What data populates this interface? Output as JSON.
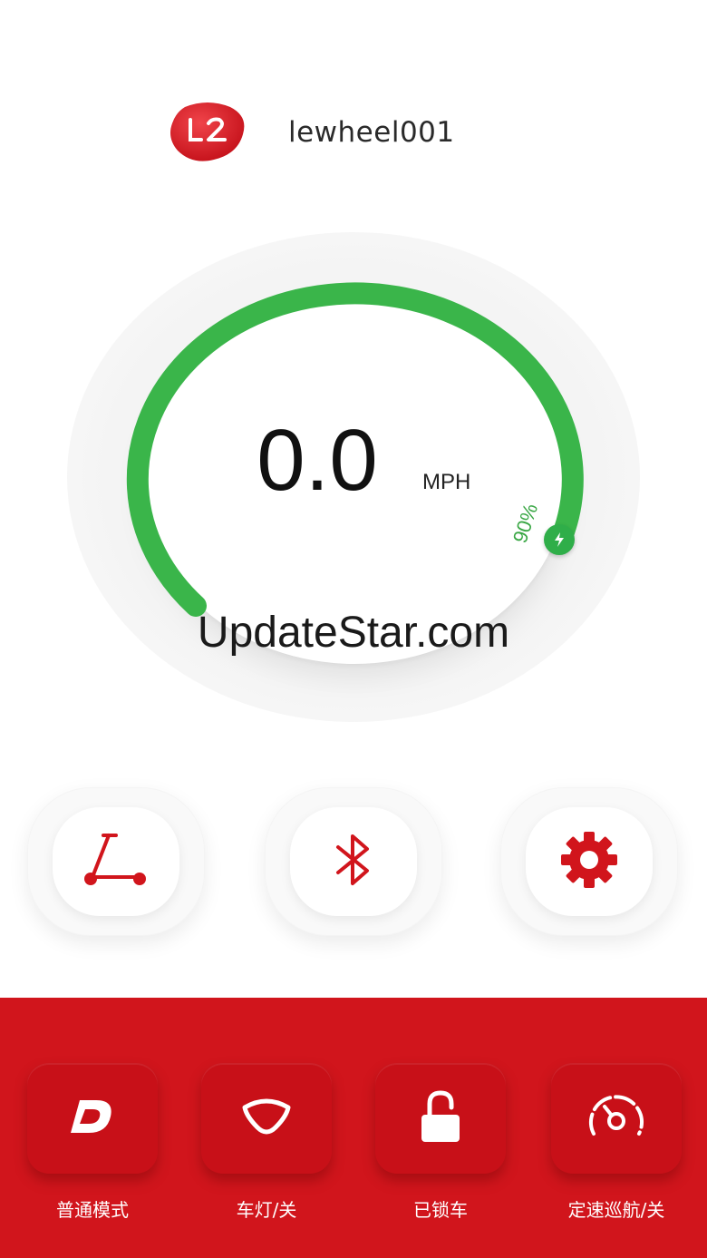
{
  "header": {
    "logo_text": "L2",
    "device_name": "lewheel001"
  },
  "gauge": {
    "speed": "0.0",
    "unit": "MPH",
    "battery_label": "90%",
    "battery_level": 0.9,
    "arc_color": "#3ab54a"
  },
  "watermark": "UpdateStar.com",
  "mid_buttons": [
    {
      "icon": "scooter-icon"
    },
    {
      "icon": "bluetooth-icon"
    },
    {
      "icon": "gear-icon"
    }
  ],
  "bottom_bar": {
    "background": "#d1151c",
    "items": [
      {
        "icon": "drive-mode-icon",
        "label": "普通模式"
      },
      {
        "icon": "headlight-icon",
        "label": "车灯/关"
      },
      {
        "icon": "lock-icon",
        "label": "已锁车"
      },
      {
        "icon": "speedometer-icon",
        "label": "定速巡航/关"
      }
    ]
  }
}
